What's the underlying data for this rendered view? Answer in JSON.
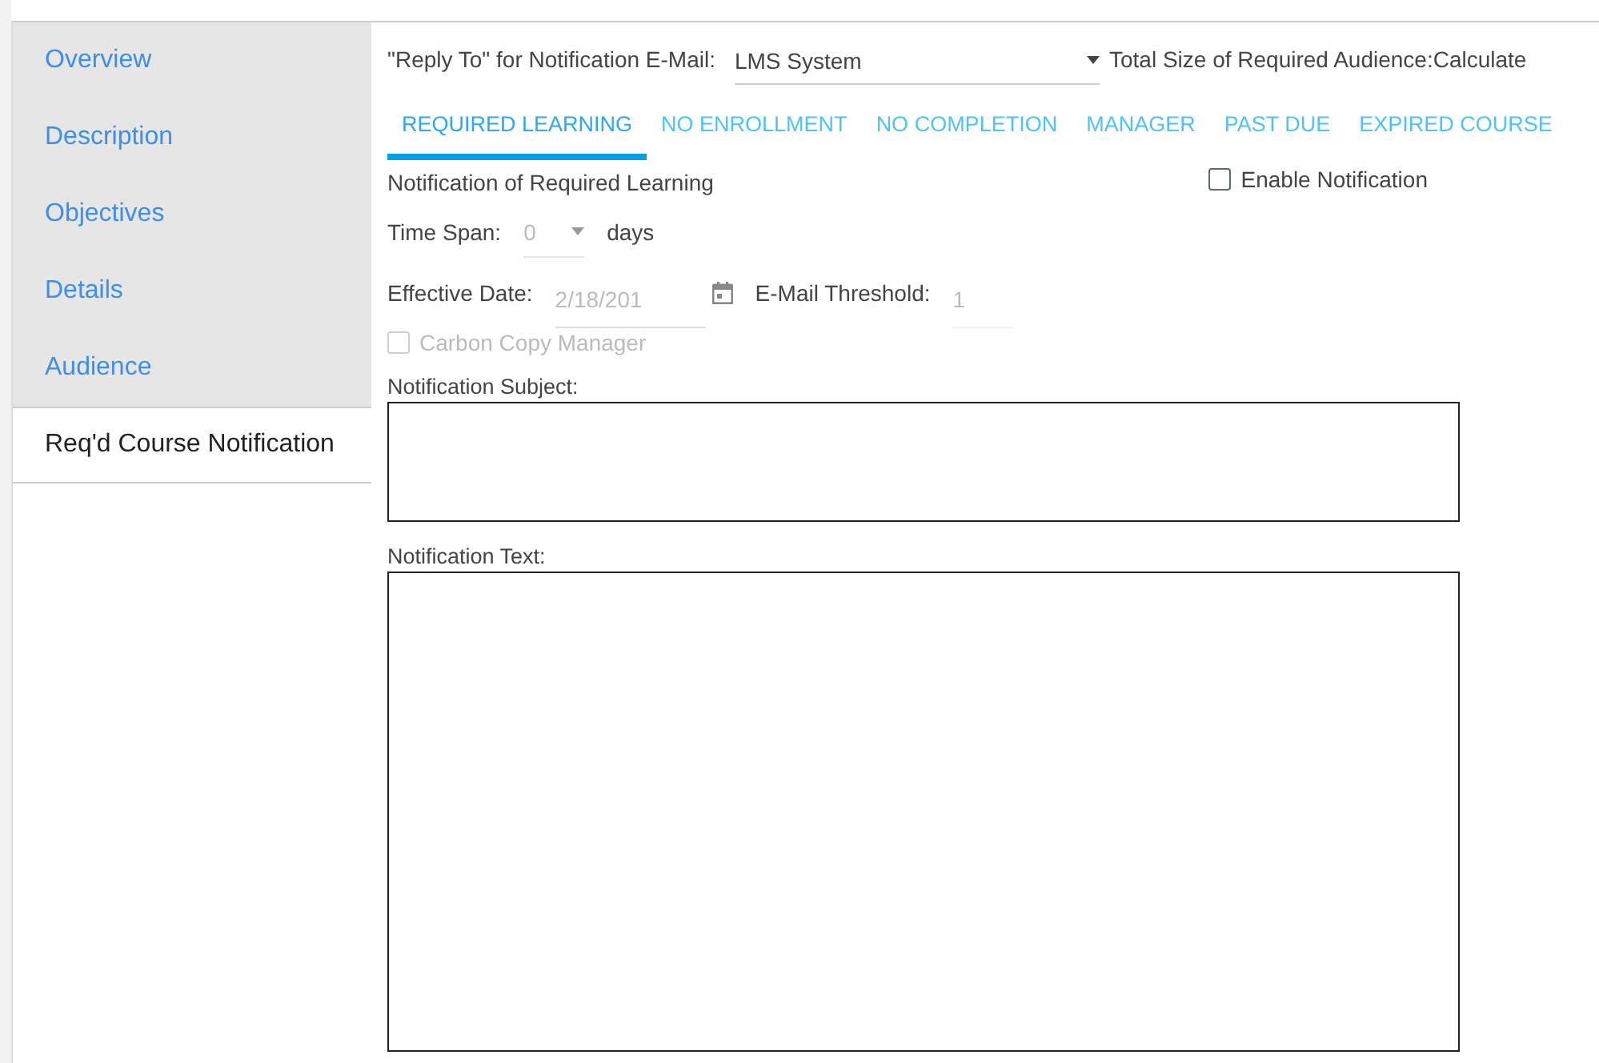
{
  "sidebar": {
    "items": [
      {
        "label": "Overview",
        "selected": false
      },
      {
        "label": "Description",
        "selected": false
      },
      {
        "label": "Objectives",
        "selected": false
      },
      {
        "label": "Details",
        "selected": false
      },
      {
        "label": "Audience",
        "selected": false
      },
      {
        "label": "Req'd Course Notification",
        "selected": true
      }
    ]
  },
  "reply_to": {
    "label": "\"Reply To\" for Notification E-Mail:",
    "value": "LMS System"
  },
  "audience_size": {
    "label": "Total Size of Required Audience:",
    "link": "Calculate"
  },
  "tabs": [
    {
      "label": "REQUIRED LEARNING",
      "selected": true
    },
    {
      "label": "NO ENROLLMENT",
      "selected": false
    },
    {
      "label": "NO COMPLETION",
      "selected": false
    },
    {
      "label": "MANAGER",
      "selected": false
    },
    {
      "label": "PAST DUE",
      "selected": false
    },
    {
      "label": "EXPIRED COURSE",
      "selected": false
    }
  ],
  "section_title": "Notification of Required Learning",
  "enable_notification": {
    "label": "Enable Notification",
    "checked": false
  },
  "time_span": {
    "label": "Time Span:",
    "value": "0",
    "unit": "days"
  },
  "effective_date": {
    "label": "Effective Date:",
    "value": "2/18/201"
  },
  "email_threshold": {
    "label": "E-Mail Threshold:",
    "value": "1"
  },
  "carbon_copy": {
    "label": "Carbon Copy Manager",
    "checked": false,
    "disabled": true
  },
  "subject": {
    "label": "Notification Subject:"
  },
  "text": {
    "label": "Notification Text:"
  }
}
